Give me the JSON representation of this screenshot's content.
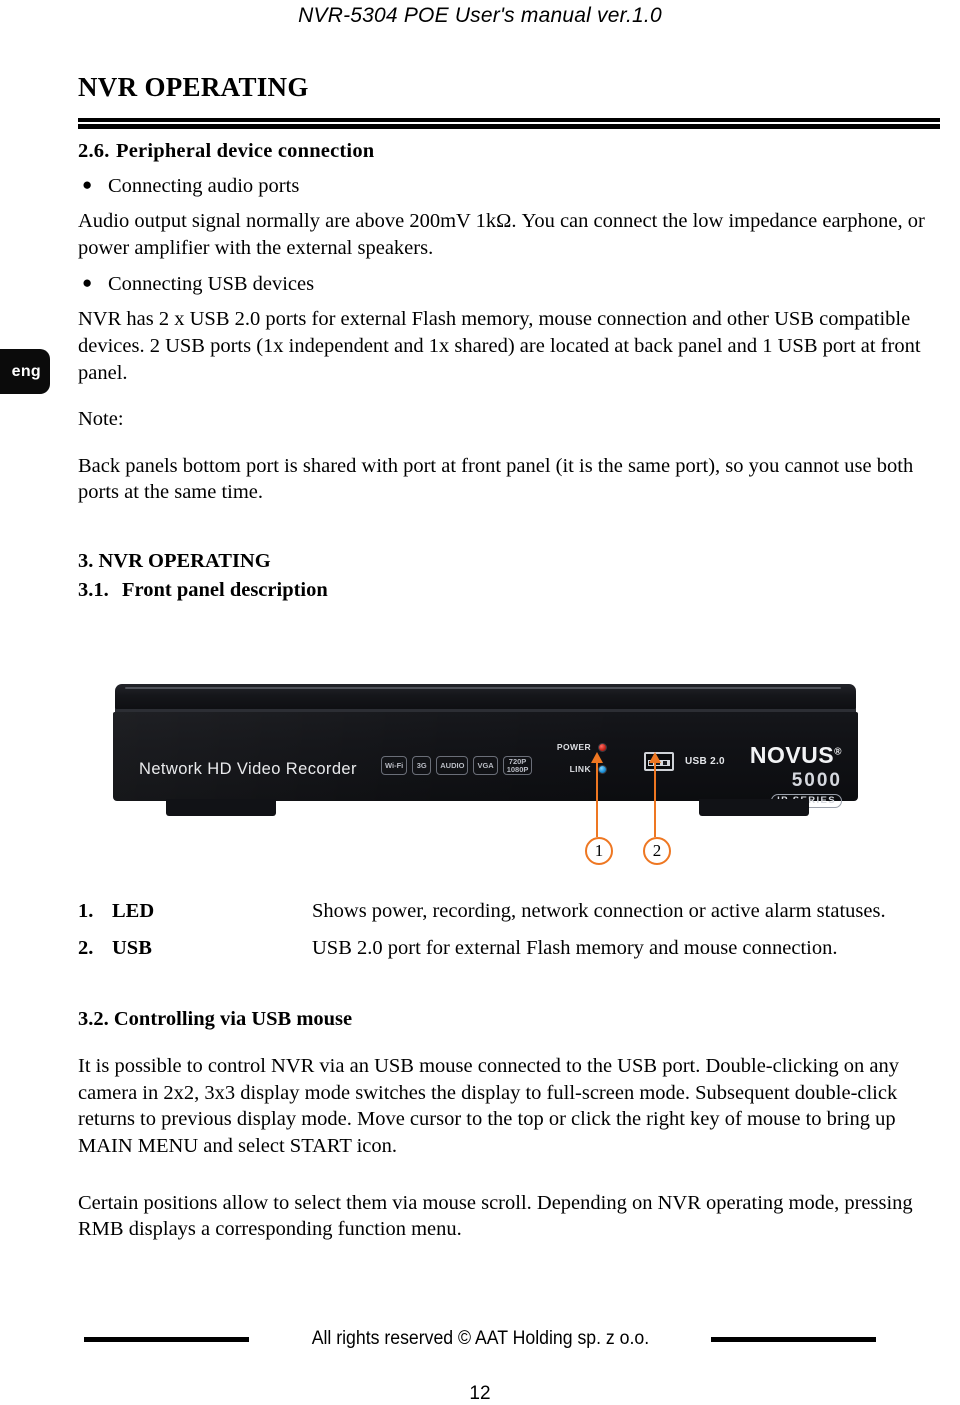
{
  "header": {
    "running_title": "NVR-5304 POE User's manual ver.1.0"
  },
  "chapter": {
    "title": "NVR OPERATING"
  },
  "language_tab": {
    "label": "eng"
  },
  "sections": {
    "s26": {
      "number": "2.6.",
      "title": "Peripheral device connection",
      "bullet1": "Connecting audio ports",
      "para1": "Audio output signal normally are above 200mV 1kΩ. You can connect the low impedance earphone, or power amplifier with the external speakers.",
      "bullet2": "Connecting USB devices",
      "para2": "NVR has 2 x USB 2.0 ports for external Flash memory, mouse connection and other USB compatible devices. 2 USB ports (1x independent and 1x shared) are located at back panel and 1 USB port at front panel.",
      "note_label": "Note:",
      "note_text": "Back panels bottom port is shared with port at front panel (it is the same port), so you cannot use both ports at the same time."
    },
    "s3": {
      "heading": "3. NVR OPERATING"
    },
    "s31": {
      "number": "3.1.",
      "title": "Front panel description"
    },
    "s32": {
      "heading": "3.2. Controlling via USB mouse",
      "para1": "It is possible to control NVR via an USB mouse connected to the USB port. Double-clicking on any camera in 2x2, 3x3 display mode switches the display to full-screen mode. Subsequent double-click returns to previous display mode. Move cursor to the top or click the right key of mouse to bring up MAIN MENU and select START icon.",
      "para2": "Certain positions allow to select them via mouse scroll. Depending on NVR operating mode, pressing RMB displays a corresponding function menu."
    }
  },
  "device": {
    "model_text": "Network HD Video Recorder",
    "badges": [
      {
        "line1": "Wi-Fi",
        "line2": ""
      },
      {
        "line1": "3G",
        "line2": ""
      },
      {
        "line1": "AUDIO",
        "line2": ""
      },
      {
        "line1": "VGA",
        "line2": ""
      },
      {
        "line1": "720P",
        "line2": "1080P"
      }
    ],
    "leds": [
      {
        "label": "POWER",
        "color": "#c32318"
      },
      {
        "label": "LINK",
        "color": "#1a8ed6"
      }
    ],
    "usb_caption": "USB 2.0",
    "brand_name": "NOVUS",
    "brand_reg": "®",
    "brand_series": "5000",
    "brand_ip": "IP SERIES"
  },
  "callouts": [
    {
      "number": "1"
    },
    {
      "number": "2"
    }
  ],
  "legend": {
    "rows": [
      {
        "num": "1.",
        "name": "LED",
        "desc": "Shows power, recording, network connection or active alarm statuses."
      },
      {
        "num": "2.",
        "name": "USB",
        "desc": "USB 2.0 port for external Flash memory and mouse connection."
      }
    ]
  },
  "footer": {
    "copyright": "All rights reserved © AAT Holding sp. z o.o.",
    "page_number": "12"
  },
  "colors": {
    "callout_orange": "#ee7722",
    "text_black": "#000000",
    "device_black": "#111216"
  }
}
